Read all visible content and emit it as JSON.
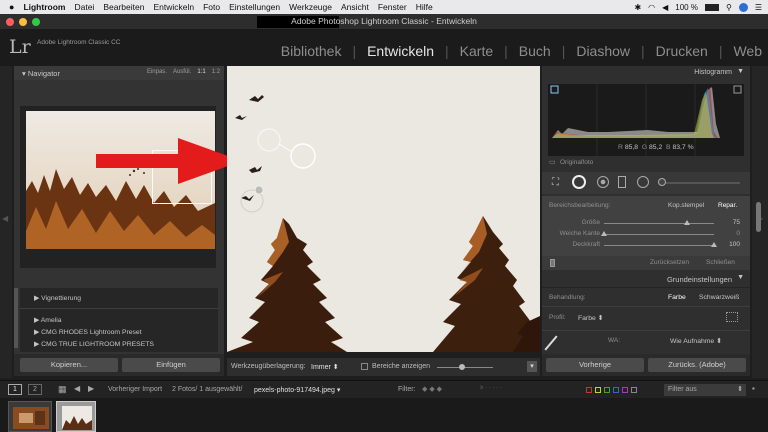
{
  "menubar": {
    "apple": "",
    "app": "Lightroom",
    "items": [
      "Datei",
      "Bearbeiten",
      "Entwickeln",
      "Foto",
      "Einstellungen",
      "Werkzeuge",
      "Ansicht",
      "Fenster",
      "Hilfe"
    ],
    "battery": "100 %"
  },
  "window": {
    "title": "Adobe Photoshop Lightroom Classic - Entwickeln"
  },
  "identity": {
    "logo": "Lr",
    "name": "Adobe Lightroom Classic CC"
  },
  "modules": [
    "Bibliothek",
    "Entwickeln",
    "Karte",
    "Buch",
    "Diashow",
    "Drucken",
    "Web"
  ],
  "navigator": {
    "title": "Navigator",
    "zooms": [
      "Einpas.",
      "Ausfül.",
      "1:1",
      "1:2"
    ],
    "presets": [
      "Vignettierung",
      "Amelia",
      "CMG RHODES Lightroom Preset",
      "CMG TRUE LIGHTROOM PRESETS"
    ]
  },
  "left_buttons": {
    "copy": "Kopieren...",
    "paste": "Einfügen"
  },
  "toolbar": {
    "overlay_label": "Werkzeugüberlagerung:",
    "overlay_value": "Immer",
    "show_areas": "Bereiche anzeigen"
  },
  "histogram": {
    "title": "Histogramm",
    "r_label": "R",
    "r": "85,8",
    "g_label": "G",
    "g": "85,2",
    "b_label": "B",
    "b": "83,7",
    "pct": "%",
    "original": "Originalfoto"
  },
  "spot": {
    "label": "Bereichsbearbeitung:",
    "mode_clone": "Kop.stempel",
    "mode_heal": "Repar.",
    "size_label": "Größe",
    "size_value": "75",
    "size_fraction": 0.75,
    "feather_label": "Weiche Kante",
    "feather_value": "0",
    "feather_fraction": 0.0,
    "opacity_label": "Deckkraft",
    "opacity_value": "100",
    "opacity_fraction": 1.0,
    "reset": "Zurücksetzen",
    "close": "Schließen"
  },
  "basic": {
    "title": "Grundeinstellungen",
    "treatment_label": "Behandlung:",
    "color": "Farbe",
    "bw": "Schwarzweiß",
    "profile_label": "Profil:",
    "profile_value": "Farbe",
    "wb_label": "WA:",
    "wb_value": "Wie Aufnahme"
  },
  "right_buttons": {
    "previous": "Vorherige",
    "reset": "Zurücks. (Adobe)"
  },
  "filmbar": {
    "page1": "1",
    "page2": "2",
    "source": "Vorheriger Import",
    "count": "2 Fotos/ 1 ausgewählt/",
    "filename": "pexels-photo-917494.jpeg",
    "filter_label": "Filter:",
    "filter_value": "Filter aus"
  },
  "colors": {
    "accent_arrow": "#e31b1b",
    "panel": "#333333",
    "background": "#1e1e1e"
  }
}
